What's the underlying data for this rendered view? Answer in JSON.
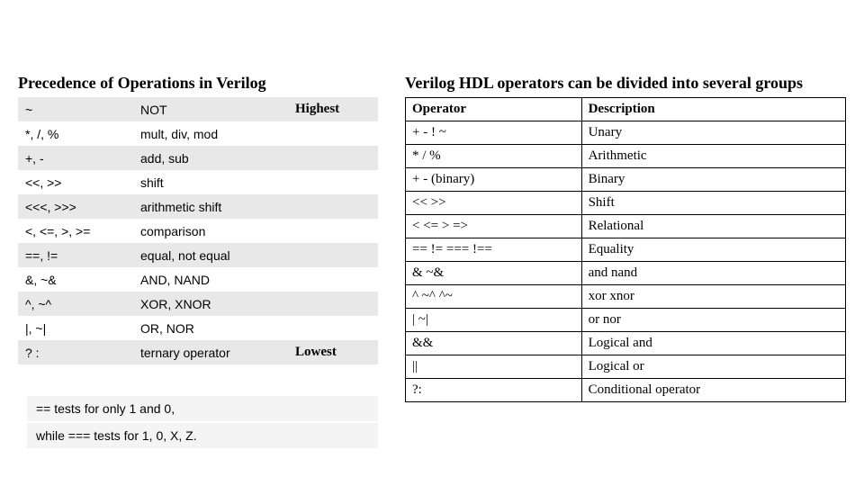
{
  "left": {
    "title": "Precedence of Operations in Verilog",
    "highest_label": "Highest",
    "lowest_label": "Lowest",
    "rows": [
      {
        "op": "~",
        "desc": "NOT"
      },
      {
        "op": "*, /, %",
        "desc": "mult, div, mod"
      },
      {
        "op": "+, -",
        "desc": "add, sub"
      },
      {
        "op": "<<, >>",
        "desc": "shift"
      },
      {
        "op": "<<<, >>>",
        "desc": "arithmetic shift"
      },
      {
        "op": "<, <=, >, >=",
        "desc": "comparison"
      },
      {
        "op": "==, !=",
        "desc": "equal, not equal"
      },
      {
        "op": "&, ~&",
        "desc": "AND, NAND"
      },
      {
        "op": "^, ~^",
        "desc": "XOR, XNOR"
      },
      {
        "op": "|, ~|",
        "desc": "OR, NOR"
      },
      {
        "op": "? :",
        "desc": "ternary operator"
      }
    ]
  },
  "right": {
    "title": "Verilog HDL operators can be divided into several groups",
    "header": {
      "op": "Operator",
      "desc": "Description"
    },
    "rows": [
      {
        "op": "+ - ! ~",
        "desc": "Unary"
      },
      {
        "op": "* / %",
        "desc": "Arithmetic"
      },
      {
        "op": "+ - (binary)",
        "desc": "Binary"
      },
      {
        "op": "<< >>",
        "desc": "Shift"
      },
      {
        "op": "< <= > =>",
        "desc": "Relational"
      },
      {
        "op": "== != === !==",
        "desc": "Equality"
      },
      {
        "op": "& ~&",
        "desc": "and nand"
      },
      {
        "op": "^ ~^ ^~",
        "desc": "xor xnor"
      },
      {
        "op": "| ~|",
        "desc": "or nor"
      },
      {
        "op": "&&",
        "desc": "Logical and"
      },
      {
        "op": "||",
        "desc": "Logical or"
      },
      {
        "op": "?:",
        "desc": "Conditional operator"
      }
    ]
  },
  "footnote": {
    "line1": "== tests for only 1 and 0,",
    "line2": "while === tests for 1, 0, X, Z."
  }
}
